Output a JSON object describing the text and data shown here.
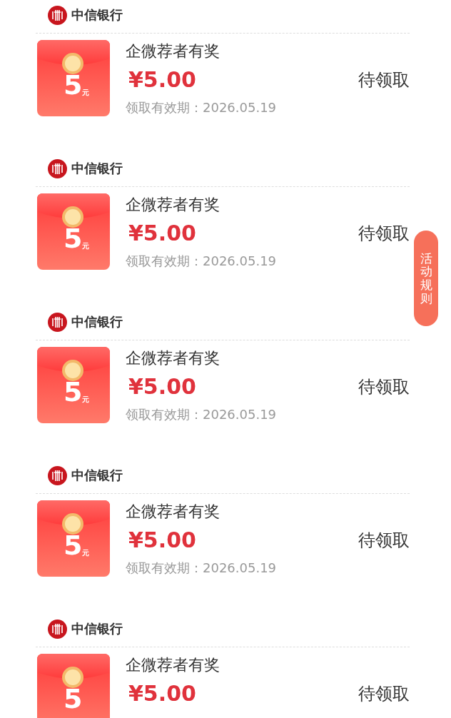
{
  "items": [
    {
      "bank": "中信银行",
      "title": "企微荐者有奖",
      "price": "¥5.00",
      "expiry": "领取有效期：2026.05.19",
      "status": "待领取",
      "envelope_amount": "5",
      "envelope_unit": "元"
    },
    {
      "bank": "中信银行",
      "title": "企微荐者有奖",
      "price": "¥5.00",
      "expiry": "领取有效期：2026.05.19",
      "status": "待领取",
      "envelope_amount": "5",
      "envelope_unit": "元"
    },
    {
      "bank": "中信银行",
      "title": "企微荐者有奖",
      "price": "¥5.00",
      "expiry": "领取有效期：2026.05.19",
      "status": "待领取",
      "envelope_amount": "5",
      "envelope_unit": "元"
    },
    {
      "bank": "中信银行",
      "title": "企微荐者有奖",
      "price": "¥5.00",
      "expiry": "领取有效期：2026.05.19",
      "status": "待领取",
      "envelope_amount": "5",
      "envelope_unit": "元"
    },
    {
      "bank": "中信银行",
      "title": "企微荐者有奖",
      "price": "¥5.00",
      "status": "待领取",
      "envelope_amount": "5"
    }
  ],
  "rules_button": "活动规则"
}
